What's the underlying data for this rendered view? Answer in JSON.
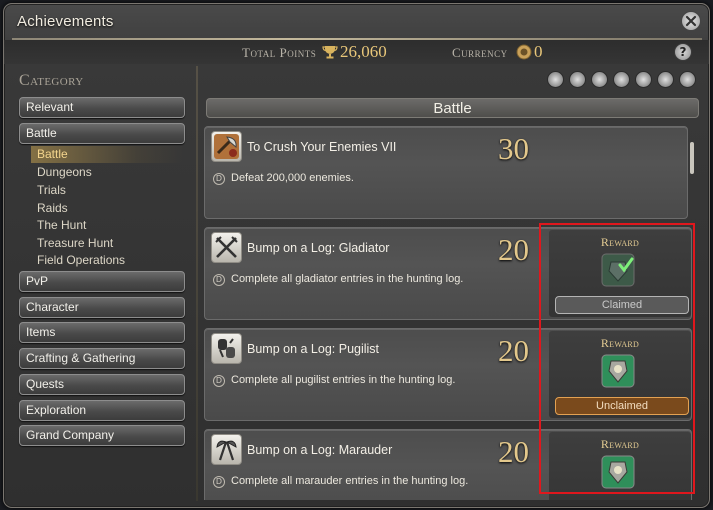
{
  "window": {
    "title": "Achievements"
  },
  "header": {
    "total_points_label": "Total Points",
    "total_points_value": "26,060",
    "currency_label": "Currency",
    "currency_value": "0",
    "help_label": "?"
  },
  "sidebar": {
    "title": "Category",
    "items": [
      {
        "label": "Relevant"
      },
      {
        "label": "Battle"
      },
      {
        "label": "PvP"
      },
      {
        "label": "Character"
      },
      {
        "label": "Items"
      },
      {
        "label": "Crafting & Gathering"
      },
      {
        "label": "Quests"
      },
      {
        "label": "Exploration"
      },
      {
        "label": "Grand Company"
      }
    ],
    "subitems": [
      {
        "label": "Battle",
        "selected": true
      },
      {
        "label": "Dungeons"
      },
      {
        "label": "Trials"
      },
      {
        "label": "Raids"
      },
      {
        "label": "The Hunt"
      },
      {
        "label": "Treasure Hunt"
      },
      {
        "label": "Field Operations"
      }
    ]
  },
  "main": {
    "section_title": "Battle",
    "filter_icons": [
      "filter-all-icon",
      "filter-weapon-icon",
      "filter-sword-icon",
      "filter-figure-icon",
      "filter-emblem-icon",
      "filter-helm-icon",
      "filter-misc-icon"
    ],
    "achievements": [
      {
        "name": "To Crush Your Enemies VII",
        "points": "30",
        "description": "Defeat 200,000 enemies.",
        "icon": "axe-enemies-icon"
      },
      {
        "name": "Bump on a Log: Gladiator",
        "points": "20",
        "description": "Complete all gladiator entries in the hunting log.",
        "icon": "swords-icon",
        "reward": {
          "label": "Reward",
          "status": "Claimed",
          "item_icon": "claimed-reward-icon"
        }
      },
      {
        "name": "Bump on a Log: Pugilist",
        "points": "20",
        "description": "Complete all pugilist entries in the hunting log.",
        "icon": "fists-icon",
        "reward": {
          "label": "Reward",
          "status": "Unclaimed",
          "item_icon": "reward-medal-icon"
        }
      },
      {
        "name": "Bump on a Log: Marauder",
        "points": "20",
        "description": "Complete all marauder entries in the hunting log.",
        "icon": "axes-icon",
        "reward": {
          "label": "Reward",
          "item_icon": "reward-medal-icon"
        }
      }
    ]
  },
  "colors": {
    "accent_gold": "#e3c88c",
    "selected_highlight": "#f4d58d",
    "annotation_red": "#e0171d",
    "unclaimed_orange": "#e3a152"
  }
}
